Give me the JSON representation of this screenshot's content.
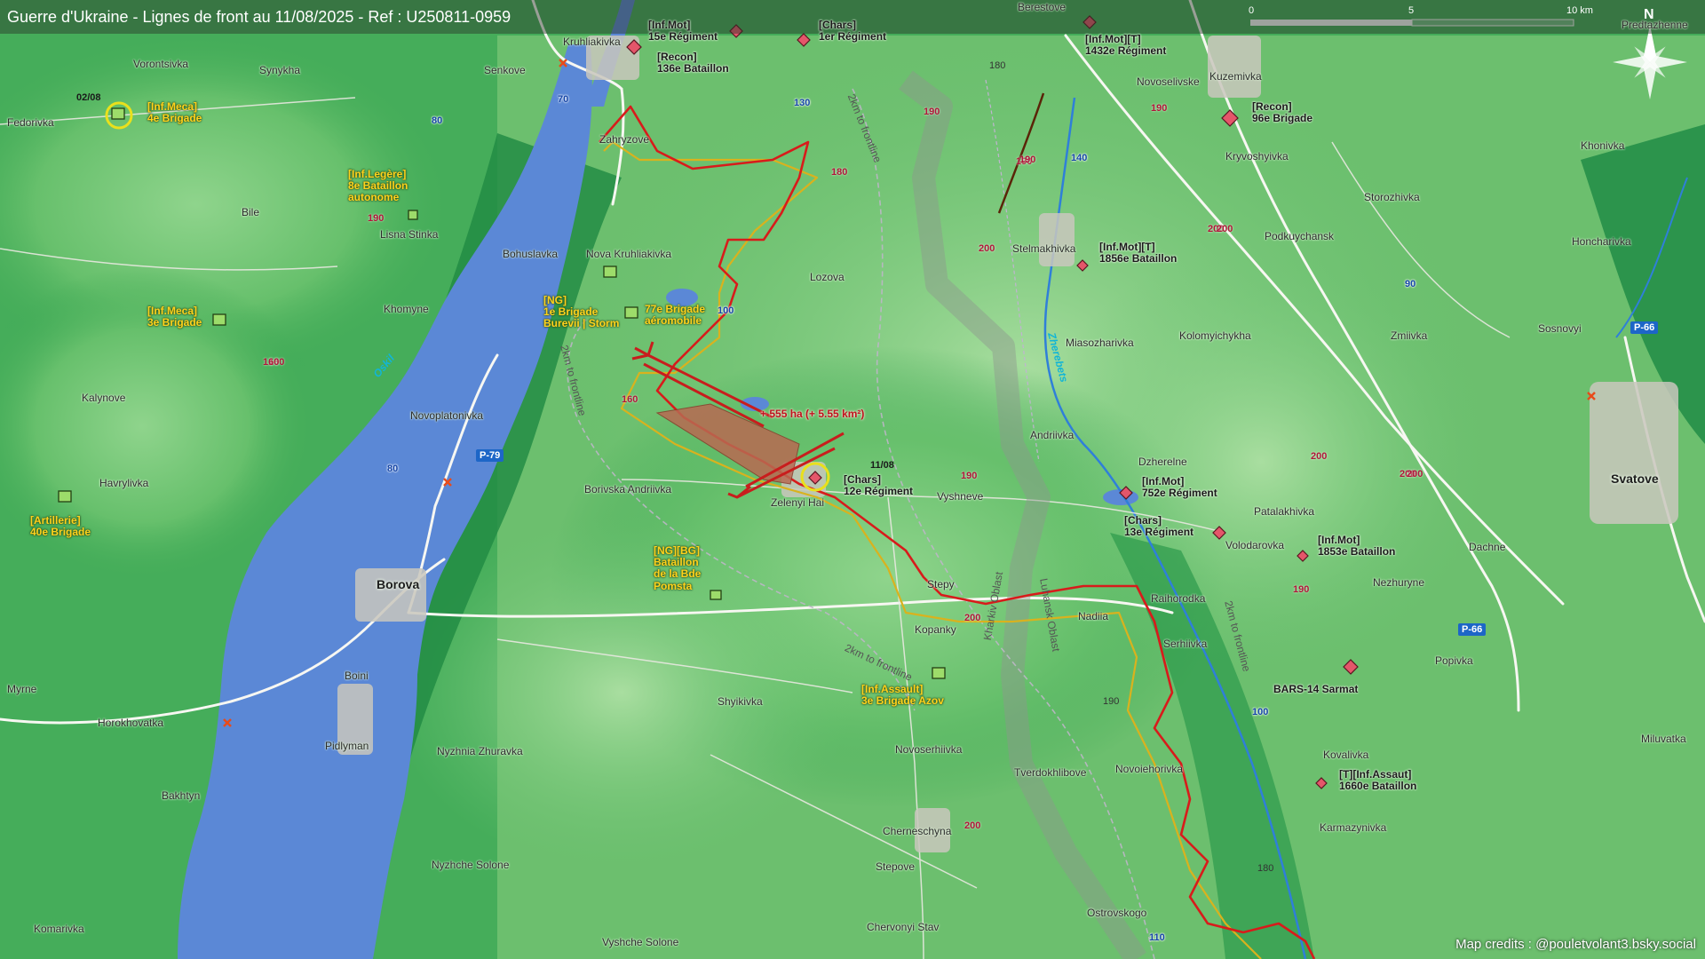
{
  "title": "Guerre d'Ukraine - Lignes de front au 11/08/2025 - Ref : U250811-0959",
  "credits": "Map credits : @pouletvolant3.bsky.social",
  "scale": {
    "zero": "0",
    "mid": "5",
    "max": "10 km"
  },
  "north": "N",
  "colors": {
    "frontline": "#d81b1b",
    "old_frontline": "#d4b21c",
    "ukraine_units": "#ffd21c",
    "russia_units": "#d94a5c",
    "water": "#5b88d6"
  },
  "gain": "+ 555 ha (+ 5.55 km²)",
  "gain_date": "11/08",
  "unit_date_tl": "02/08",
  "towns": {
    "berestove": "Berestove",
    "kruhliakivka": "Kruhliakivka",
    "senkove": "Senkove",
    "vorontsivka": "Vorontsivka",
    "synykha": "Synykha",
    "fedorivka": "Fedorivka",
    "zahryzove": "Zahryzove",
    "bile": "Bile",
    "lisna_stinka": "Lisna Stinka",
    "bohuslavka": "Bohuslavka",
    "nova_kruhliakivka": "Nova Kruhliakivka",
    "lozova": "Lozova",
    "khomyne": "Khomyne",
    "kalynove": "Kalynove",
    "novoplatonivka": "Novoplatonivka",
    "havrylivka": "Havrylivka",
    "borivska_andriivka": "Borivska Andriivka",
    "zelenyi_hai": "Zelenyi Hai",
    "vyshneve": "Vyshneve",
    "borova": "Borova",
    "stepy": "Stepy",
    "kopanky": "Kopanky",
    "nadiia": "Nadiia",
    "serhiivka": "Serhiivka",
    "raihorodka": "Raihorodka",
    "boini": "Boini",
    "myrne": "Myrne",
    "horokhovatka": "Horokhovatka",
    "shyikivka": "Shyikivka",
    "pidlyman": "Pidlyman",
    "nyzhnia_zhuravka": "Nyzhnia Zhuravka",
    "bakhtyn": "Bakhtyn",
    "novoserhiivka": "Novoserhiivka",
    "tverdokhlibove": "Tverdokhlibove",
    "novoiehorivka": "Novoiehorivka",
    "cherneschyna": "Cherneschyna",
    "stepove": "Stepove",
    "nyzhche_solone": "Nyzhche Solone",
    "komarivka": "Komarivka",
    "vyshche_solone": "Vyshche Solone",
    "chervonyi_stav": "Chervonyi Stav",
    "ostrovskogo": "Ostrovskogo",
    "novoselivske": "Novoselivske",
    "kuzemivka": "Kuzemivka",
    "kryvoshyivka": "Kryvoshyivka",
    "storozhivka": "Storozhivka",
    "stelmakhivka": "Stelmakhivka",
    "podkuychansk": "Podkuychansk",
    "khonivka": "Khonivka",
    "honcharivka": "Honcharivka",
    "miasozharivka": "Miasozharivka",
    "kolomyichykha": "Kolomyichykha",
    "zmiivka": "Zmiivka",
    "sosnovyi": "Sosnovyi",
    "andriivka": "Andriivka",
    "dzherelne": "Dzherelne",
    "svatove": "Svatove",
    "patalakhivka": "Patalakhivka",
    "volodarovka": "Volodarovka",
    "dachne": "Dachne",
    "nezhuryne": "Nezhuryne",
    "popivka": "Popivka",
    "kovalivka": "Kovalivka",
    "karmazynivka": "Karmazynivka",
    "miluvatka": "Miluvatka",
    "predtechyne": "Predtazhenne"
  },
  "units_ua": {
    "inf_meca_4": "[Inf.Meca]\n4e Brigade",
    "inf_legere_8": "[Inf.Legère]\n8e Bataillon\nautonome",
    "ng_1": "[NG]\n1e Brigade\nBurevii | Storm",
    "airmobile_77": "77e Brigade\naéromobile",
    "inf_meca_3": "[Inf.Meca]\n3e Brigade",
    "artillerie_40": "[Artillerie]\n40e Brigade",
    "ng_bg": "[NG][BG]\nBataillon\nde la Bde\nPomsta",
    "azov": "[Inf.Assault]\n3e Brigade Azov"
  },
  "units_ru": {
    "inf_mot_15": "[Inf.Mot]\n15e Régiment",
    "recon_136": "[Recon]\n136e Bataillon",
    "chars_1": "[Chars]\n1er Régiment",
    "inf_mot_t_1432": "[Inf.Mot][T]\n1432e Régiment",
    "recon_96": "[Recon]\n96e Brigade",
    "inf_mot_t_1856": "[Inf.Mot][T]\n1856e Bataillon",
    "chars_12": "[Chars]\n12e Régiment",
    "inf_mot_752": "[Inf.Mot]\n752e Régiment",
    "chars_13": "[Chars]\n13e Régiment",
    "inf_mot_1853": "[Inf.Mot]\n1853e Bataillon",
    "bars14": "BARS-14 Sarmat",
    "t_inf_assault_1660": "[T][Inf.Assaut]\n1660e Bataillon"
  },
  "elevations": [
    "190",
    "180",
    "160",
    "200",
    "190",
    "200",
    "190",
    "190",
    "190",
    "200",
    "200",
    "200",
    "200",
    "190",
    "160",
    "190",
    "190",
    "200",
    "180",
    "180",
    "200",
    "160"
  ],
  "road_badges": {
    "p79": "P-79",
    "p66a": "P-66",
    "p66b": "P-66"
  },
  "road_numbers": {
    "r70": "70",
    "r80a": "80",
    "r80b": "80",
    "r130": "130",
    "r100a": "100",
    "r100b": "100",
    "r140": "140",
    "r90": "90",
    "r110": "110"
  },
  "rivers": {
    "oskil": "Oskil",
    "zherebets": "Zherebets"
  },
  "regions": {
    "kharkiv": "Kharkiv Oblast",
    "luhansk": "Luhansk Oblast"
  },
  "buffer_label": "2km to frontline"
}
